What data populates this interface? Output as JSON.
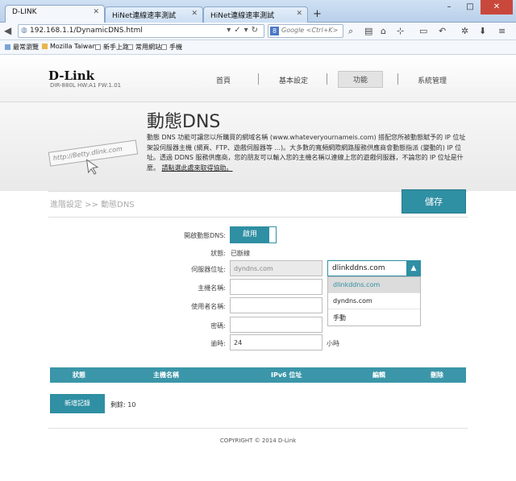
{
  "browser": {
    "tabs": [
      {
        "label": "D-LINK",
        "active": true
      },
      {
        "label": "HiNet連線速率測試",
        "active": false
      },
      {
        "label": "HiNet連線速率測試",
        "active": false
      }
    ],
    "new_tab": "+",
    "window_buttons": {
      "minimize": "–",
      "maximize": "□",
      "close": "✕"
    },
    "url": "192.168.1.1/DynamicDNS.html",
    "search_placeholder": "Google <Ctrl+K>",
    "bookmarks": [
      "最常瀏覽",
      "Mozilla Taiwan",
      "新手上路",
      "常用網站",
      "手機"
    ]
  },
  "router": {
    "logo": "D-Link",
    "model_info": "DIR-880L   HW:A1   FW:1.01",
    "menu": [
      "首頁",
      "基本設定",
      "功能",
      "系統管理"
    ],
    "active_menu": "功能",
    "page_title": "動態DNS",
    "banner_art_text": "http://Betty.dlink.com",
    "description": "動態 DNS 功能可讓您以所購買的網域名稱 (www.whateveryournameis.com) 搭配您所被動態賦予的 IP 位址架設伺服器主機 (網頁、FTP、遊戲伺服器等 ...)。大多數的寬頻網際網路服務供應商會動態指派 (變動的) IP 位址。透過 DDNS 服務供應商，您的朋友可以輸入您的主機名稱以連線上您的遊戲伺服器，不論您的 IP 位址是什麼。",
    "description_link": "請點選此處來取得協助。",
    "breadcrumb": "進階設定 >> 動態DNS",
    "save_label": "儲存",
    "form": {
      "enable_label": "開啟動態DNS:",
      "enable_value": "啟用",
      "status_label": "狀態:",
      "status_value": "已斷線",
      "server_label": "伺服器位址:",
      "server_value": "dyndns.com",
      "server_select_value": "dlinkddns.com",
      "server_options": [
        "dlinkddns.com",
        "dyndns.com",
        "手動"
      ],
      "host_label": "主機名稱:",
      "host_value": "",
      "user_label": "使用者名稱:",
      "user_value": "",
      "password_label": "密碼:",
      "password_value": "",
      "timeout_label": "逾時:",
      "timeout_value": "24",
      "timeout_unit": "小時"
    },
    "table": {
      "columns": [
        "狀態",
        "主機名稱",
        "IPv6 位址",
        "編輯",
        "刪除"
      ]
    },
    "add_record_label": "新增記錄",
    "remaining": "剩餘: 10",
    "copyright": "COPYRIGHT © 2014 D-Link"
  }
}
